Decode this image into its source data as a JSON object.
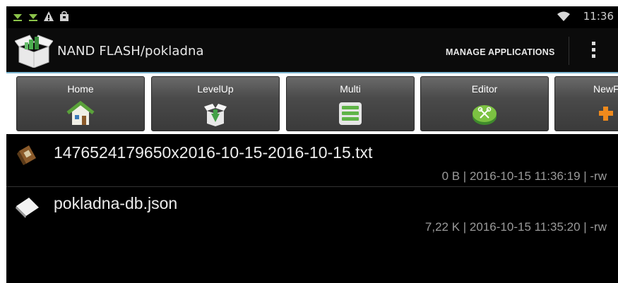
{
  "status_bar": {
    "icons_left": [
      "download-icon",
      "download-icon",
      "warning-icon",
      "shopping-bag-icon"
    ],
    "time": "11:36",
    "icons_right": [
      "wifi-icon"
    ]
  },
  "action_bar": {
    "title": "NAND FLASH/pokladna",
    "manage_label": "MANAGE APPLICATIONS",
    "accent_line_color": "#7fb8d4"
  },
  "toolbar": {
    "buttons": [
      {
        "label": "Home",
        "icon": "home-icon"
      },
      {
        "label": "LevelUp",
        "icon": "level-up-icon"
      },
      {
        "label": "Multi",
        "icon": "multi-select-icon"
      },
      {
        "label": "Editor",
        "icon": "editor-icon"
      },
      {
        "label": "NewF",
        "icon": "new-folder-icon"
      }
    ]
  },
  "files": [
    {
      "name": "1476524179650x2016-10-15-2016-10-15.txt",
      "meta": "0 B | 2016-10-15 11:36:19 | -rw",
      "icon": "text-file-icon"
    },
    {
      "name": "pokladna-db.json",
      "meta": "7,22 K | 2016-10-15 11:35:20 | -rw",
      "icon": "generic-file-icon"
    }
  ]
}
